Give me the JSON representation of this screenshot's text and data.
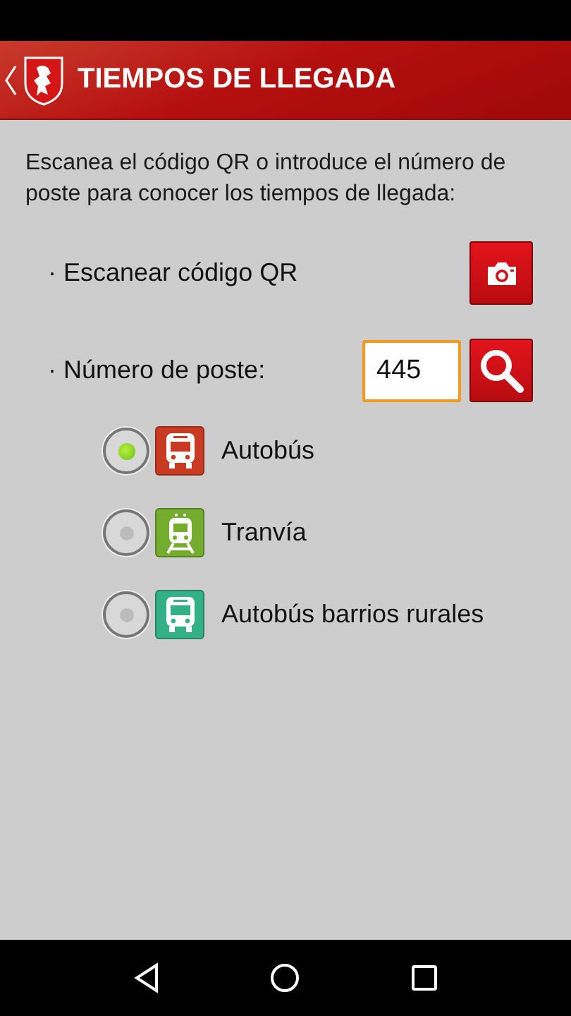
{
  "header": {
    "title": "TIEMPOS DE LLEGADA"
  },
  "intro": "Escanea el código QR o introduce el número de poste para conocer los tiempos de llegada:",
  "scan": {
    "label": "· Escanear código QR"
  },
  "stop": {
    "label": "· Número de poste:",
    "value": "445"
  },
  "options": [
    {
      "label": "Autobús",
      "kind": "bus",
      "color": "#c83a22",
      "selected": true
    },
    {
      "label": "Tranvía",
      "kind": "tram",
      "color": "#74ad2e",
      "selected": false
    },
    {
      "label": "Autobús barrios rurales",
      "kind": "bus",
      "color": "#34b086",
      "selected": false
    }
  ]
}
